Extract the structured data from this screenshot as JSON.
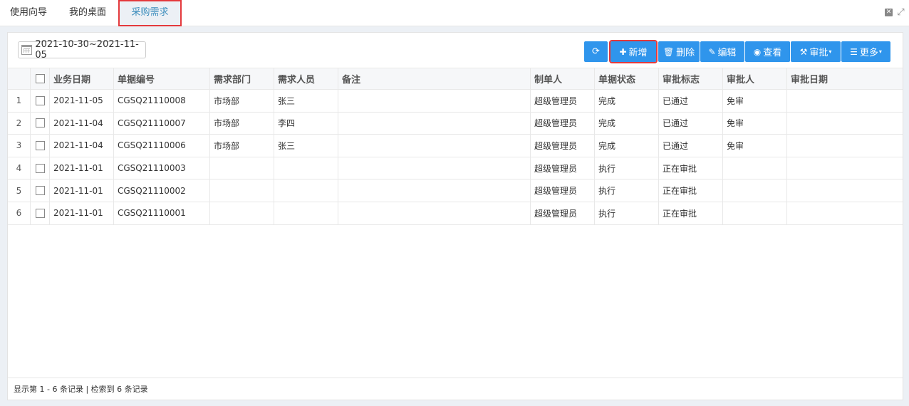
{
  "tabs": [
    {
      "label": "使用向导"
    },
    {
      "label": "我的桌面"
    },
    {
      "label": "采购需求"
    }
  ],
  "window_icons": {
    "close": "close-icon",
    "expand": "expand-icon"
  },
  "date_range": {
    "value": "2021-10-30~2021-11-05",
    "icon": "calendar-icon"
  },
  "toolbar": {
    "refresh_icon": "refresh-icon",
    "add_label": "新增",
    "delete_label": "删除",
    "edit_label": "编辑",
    "view_label": "查看",
    "approve_label": "审批",
    "more_label": "更多"
  },
  "colors": {
    "accent": "#2f95ec",
    "highlight": "#e4393c",
    "active_tab": "#3c8dbc"
  },
  "table": {
    "headers": [
      "业务日期",
      "单据编号",
      "需求部门",
      "需求人员",
      "备注",
      "制单人",
      "单据状态",
      "审批标志",
      "审批人",
      "审批日期"
    ],
    "rows": [
      {
        "num": "1",
        "date": "2021-11-05",
        "code": "CGSQ21110008",
        "dept": "市场部",
        "person": "张三",
        "remark": "",
        "creator": "超级管理员",
        "status": "完成",
        "flag": "已通过",
        "approver": "免审",
        "approve_date": ""
      },
      {
        "num": "2",
        "date": "2021-11-04",
        "code": "CGSQ21110007",
        "dept": "市场部",
        "person": "李四",
        "remark": "",
        "creator": "超级管理员",
        "status": "完成",
        "flag": "已通过",
        "approver": "免审",
        "approve_date": ""
      },
      {
        "num": "3",
        "date": "2021-11-04",
        "code": "CGSQ21110006",
        "dept": "市场部",
        "person": "张三",
        "remark": "",
        "creator": "超级管理员",
        "status": "完成",
        "flag": "已通过",
        "approver": "免审",
        "approve_date": ""
      },
      {
        "num": "4",
        "date": "2021-11-01",
        "code": "CGSQ21110003",
        "dept": "",
        "person": "",
        "remark": "",
        "creator": "超级管理员",
        "status": "执行",
        "flag": "正在审批",
        "approver": "",
        "approve_date": ""
      },
      {
        "num": "5",
        "date": "2021-11-01",
        "code": "CGSQ21110002",
        "dept": "",
        "person": "",
        "remark": "",
        "creator": "超级管理员",
        "status": "执行",
        "flag": "正在审批",
        "approver": "",
        "approve_date": ""
      },
      {
        "num": "6",
        "date": "2021-11-01",
        "code": "CGSQ21110001",
        "dept": "",
        "person": "",
        "remark": "",
        "creator": "超级管理员",
        "status": "执行",
        "flag": "正在审批",
        "approver": "",
        "approve_date": ""
      }
    ]
  },
  "footer": {
    "text": "显示第 1 - 6 条记录 | 检索到 6 条记录"
  }
}
